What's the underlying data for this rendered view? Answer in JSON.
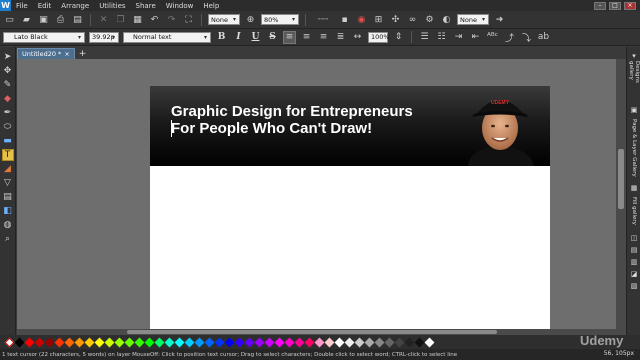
{
  "app": {
    "logo_letter": "W"
  },
  "menu": {
    "items": [
      "File",
      "Edit",
      "Arrange",
      "Utilities",
      "Share",
      "Window",
      "Help"
    ]
  },
  "toolbar1": {
    "fill_select": "None",
    "zoom_select": "80%",
    "stroke_select": "None"
  },
  "toolbar2": {
    "font_family": "Lato Black",
    "font_size": "39.92p",
    "text_style": "Normal text",
    "bold_label": "B",
    "italic_label": "I",
    "underline_label": "U",
    "strike_label": "S",
    "zoom_text": "100%"
  },
  "tabs": [
    {
      "label": "Untitled20 *"
    }
  ],
  "right_panel": {
    "tabs": [
      "Designs gallery",
      "Page & Layer Gallery",
      "Fill gallery"
    ]
  },
  "page": {
    "banner_line1": "Graphic Design for Entrepreneurs",
    "banner_line2": "For People Who Can't Draw!",
    "cap_text": "UDEMY"
  },
  "palette": {
    "colors": [
      "#000000",
      "#ff0000",
      "#cc0000",
      "#990000",
      "#ff3300",
      "#ff6600",
      "#ff9900",
      "#ffcc00",
      "#ffff00",
      "#ccff00",
      "#99ff00",
      "#66ff00",
      "#33ff00",
      "#00ff00",
      "#00ff66",
      "#00ffcc",
      "#00ffff",
      "#00ccff",
      "#0099ff",
      "#0066ff",
      "#0033ff",
      "#0000ff",
      "#3300ff",
      "#6600ff",
      "#9900ff",
      "#cc00ff",
      "#ff00ff",
      "#ff00cc",
      "#ff0099",
      "#ff0066",
      "#ff99cc",
      "#ffcccc",
      "#ffffff",
      "#eeeeee",
      "#cccccc",
      "#aaaaaa",
      "#888888",
      "#666666",
      "#444444",
      "#222222",
      "#111111",
      "#ffffff"
    ]
  },
  "status": {
    "text": "1 text cursor (22 characters, 5 words) on layer MouseOff: Click to position text cursor; Drag to select characters; Double click to select word; CTRL-click to select line",
    "coords": "56, 105px"
  },
  "watermark": "Udemy"
}
